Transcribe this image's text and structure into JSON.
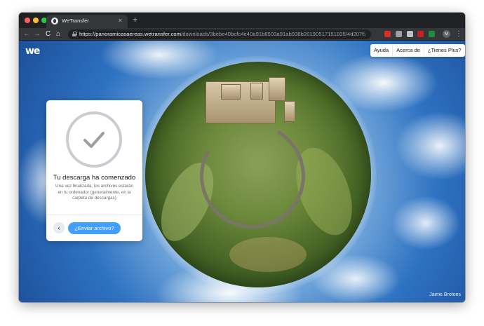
{
  "browser": {
    "tab_title": "WeTransfer",
    "tab_close": "×",
    "new_tab": "+",
    "nav_back": "←",
    "nav_forward": "→",
    "nav_reload": "C",
    "nav_home": "⌂",
    "url_base": "https://panoramicasaereas.wetransfer.com",
    "url_path": "/downloads/3bebe40bcfc4e40a91b8503a91ab938b20190517151835/4d207f",
    "bookmark_star": "☆",
    "profile_initial": "M",
    "menu": "⋮",
    "extensions": [
      {
        "name": "ext-red-icon",
        "color": "#d93025"
      },
      {
        "name": "ext-grey-icon",
        "color": "#9aa0a6"
      },
      {
        "name": "ext-grey2-icon",
        "color": "#bdc1c6"
      },
      {
        "name": "ext-gmail-icon",
        "color": "#c5221f"
      },
      {
        "name": "ext-green-icon",
        "color": "#1e8e3e"
      }
    ]
  },
  "page": {
    "logo": "we",
    "nav": [
      "Ayuda",
      "Acerca de",
      "¿Tienes Plus?"
    ],
    "photo_credit": "Jaime Brotons"
  },
  "panel": {
    "title": "Tu descarga ha comenzado",
    "body": "Una vez finalizada, los archivos estarán en tu ordenador (generalmente, en la carpeta de descargas)",
    "back": "‹",
    "send_button": "¿Enviar archivo?"
  },
  "colors": {
    "accent": "#409fff",
    "browser_bg": "#202124",
    "toolbar_bg": "#35363a"
  }
}
